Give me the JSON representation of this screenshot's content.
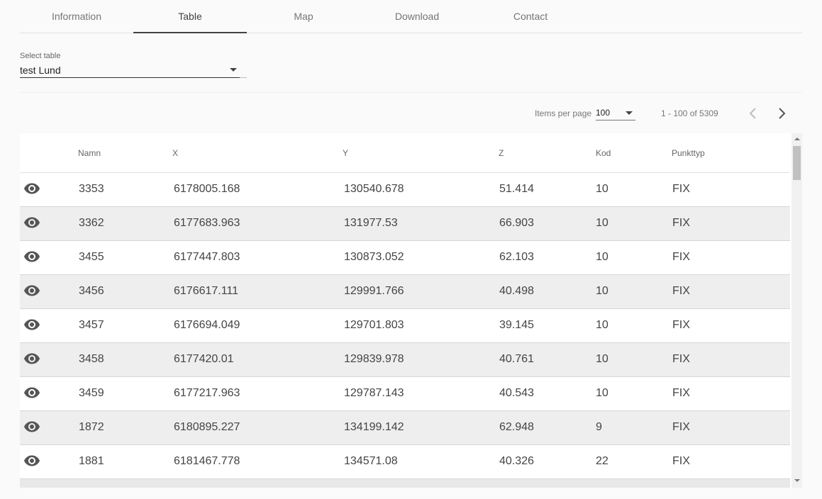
{
  "tabs": [
    {
      "label": "Information",
      "active": false
    },
    {
      "label": "Table",
      "active": true
    },
    {
      "label": "Map",
      "active": false
    },
    {
      "label": "Download",
      "active": false
    },
    {
      "label": "Contact",
      "active": false
    }
  ],
  "table_select": {
    "label": "Select table",
    "value": "test Lund"
  },
  "paginator": {
    "items_per_page_label": "Items per page",
    "items_per_page_value": "100",
    "range_label": "1 - 100 of 5309"
  },
  "table": {
    "headers": {
      "namn": "Namn",
      "x": "X",
      "y": "Y",
      "z": "Z",
      "kod": "Kod",
      "punkttyp": "Punkttyp"
    },
    "rows": [
      {
        "namn": "3353",
        "x": "6178005.168",
        "y": "130540.678",
        "z": "51.414",
        "kod": "10",
        "punkttyp": "FIX"
      },
      {
        "namn": "3362",
        "x": "6177683.963",
        "y": "131977.53",
        "z": "66.903",
        "kod": "10",
        "punkttyp": "FIX"
      },
      {
        "namn": "3455",
        "x": "6177447.803",
        "y": "130873.052",
        "z": "62.103",
        "kod": "10",
        "punkttyp": "FIX"
      },
      {
        "namn": "3456",
        "x": "6176617.111",
        "y": "129991.766",
        "z": "40.498",
        "kod": "10",
        "punkttyp": "FIX"
      },
      {
        "namn": "3457",
        "x": "6176694.049",
        "y": "129701.803",
        "z": "39.145",
        "kod": "10",
        "punkttyp": "FIX"
      },
      {
        "namn": "3458",
        "x": "6177420.01",
        "y": "129839.978",
        "z": "40.761",
        "kod": "10",
        "punkttyp": "FIX"
      },
      {
        "namn": "3459",
        "x": "6177217.963",
        "y": "129787.143",
        "z": "40.543",
        "kod": "10",
        "punkttyp": "FIX"
      },
      {
        "namn": "1872",
        "x": "6180895.227",
        "y": "134199.142",
        "z": "62.948",
        "kod": "9",
        "punkttyp": "FIX"
      },
      {
        "namn": "1881",
        "x": "6181467.778",
        "y": "134571.08",
        "z": "40.326",
        "kod": "22",
        "punkttyp": "FIX"
      }
    ]
  },
  "icons": {
    "row_action": "eye-icon",
    "prev": "chevron-left-icon",
    "next": "chevron-right-icon"
  }
}
